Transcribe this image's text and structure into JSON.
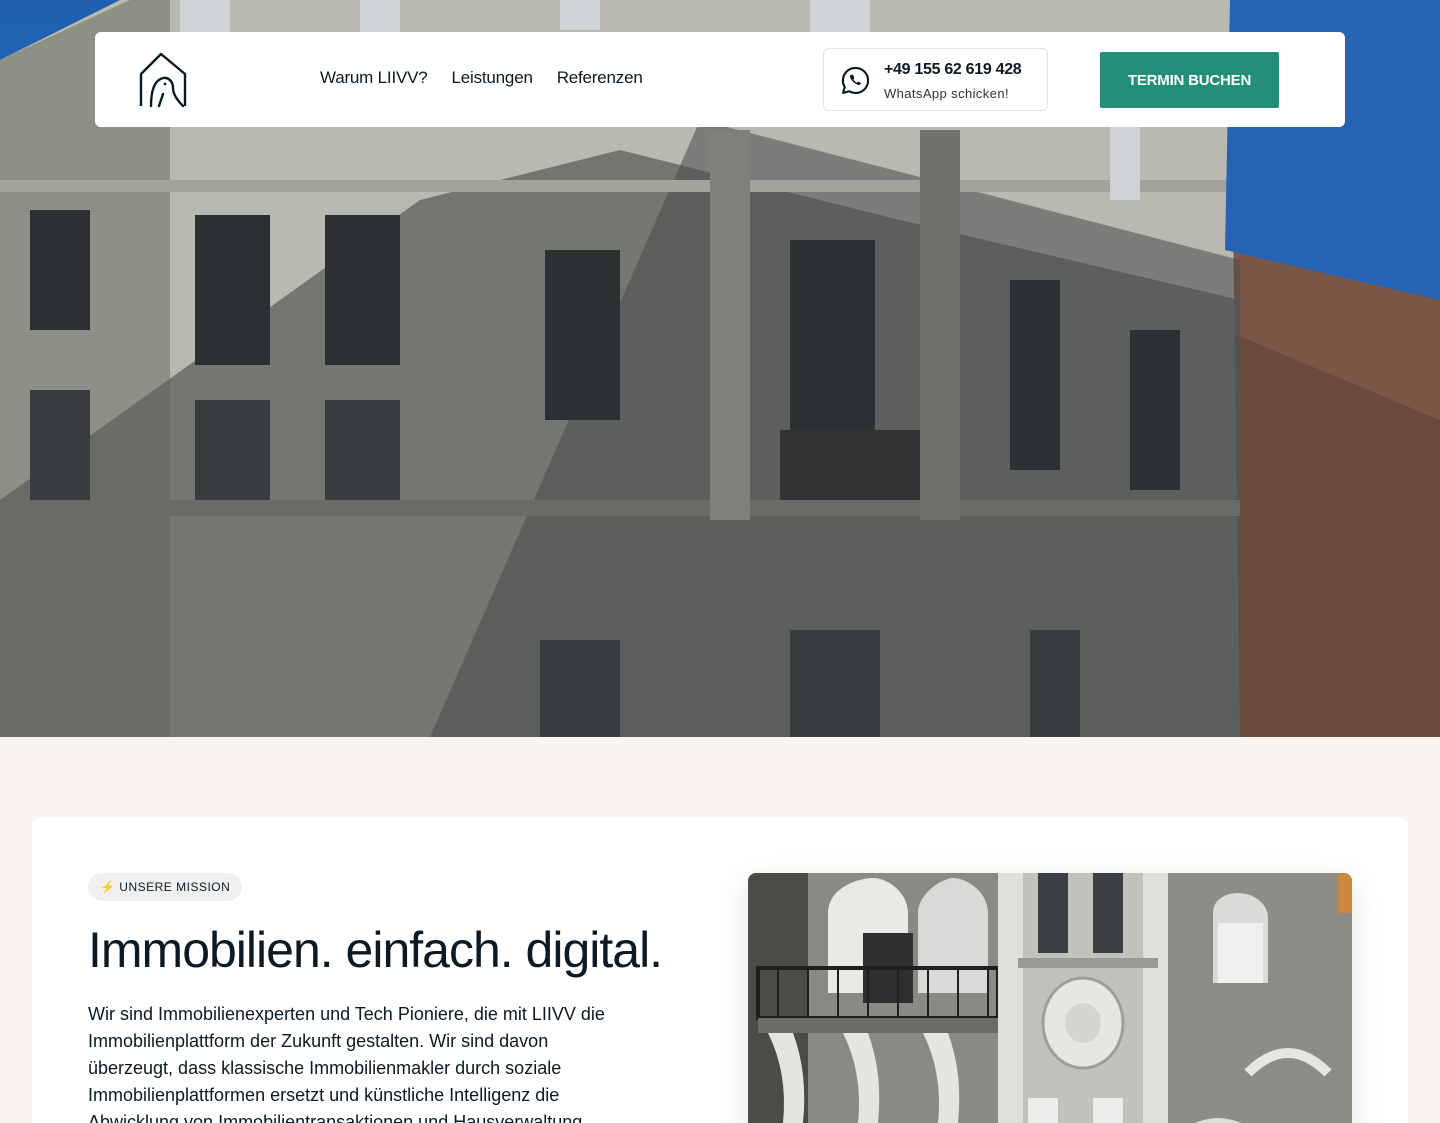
{
  "nav": {
    "items": [
      {
        "label": "Warum LIIVV?"
      },
      {
        "label": "Leistungen"
      },
      {
        "label": "Referenzen"
      }
    ],
    "whatsapp": {
      "phone": "+49 155 62 619 428",
      "cta": "WhatsApp schicken!"
    },
    "book_label": "TERMIN BUCHEN"
  },
  "mission": {
    "badge": "⚡ UNSERE MISSION",
    "headline": "Immobilien. einfach. digital.",
    "text": "Wir sind Immobilienexperten und Tech Pioniere, die mit LIIVV die Immobilienplattform der Zukunft gestalten. Wir sind davon überzeugt, dass klassische Immobilienmakler durch soziale Immobilienplattformen ersetzt und künstliche Intelligenz die Abwicklung von Immobilientransaktionen und Hausverwaltung"
  },
  "colors": {
    "accent": "#248f78",
    "text": "#0c1a26",
    "background": "#f8f4ef",
    "sky": "#2a6cc0"
  },
  "icons": {
    "logo": "house-bird-logo",
    "whatsapp": "whatsapp-icon"
  }
}
